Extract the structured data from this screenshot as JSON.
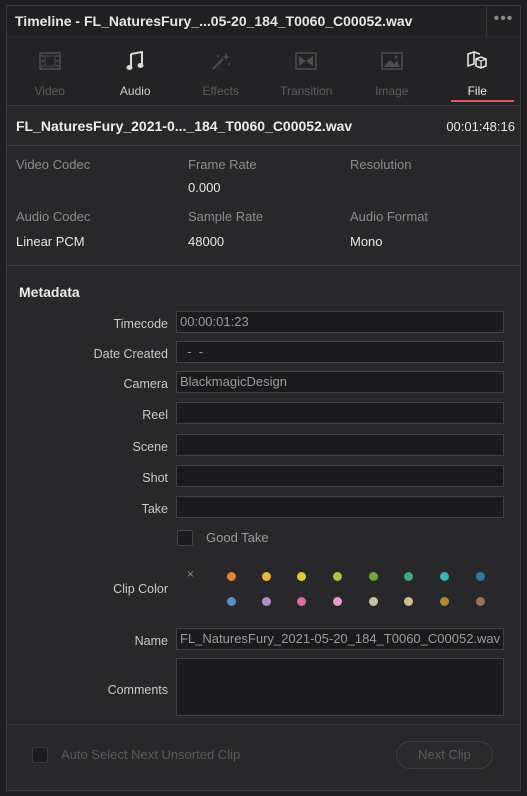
{
  "window": {
    "title": "Timeline - FL_NaturesFury_...05-20_184_T0060_C00052.wav",
    "menu": "•••"
  },
  "tabs": [
    {
      "label": "Video",
      "icon": "film-strip-icon",
      "state": "disabled"
    },
    {
      "label": "Audio",
      "icon": "music-note-icon",
      "state": "enabled"
    },
    {
      "label": "Effects",
      "icon": "magic-wand-icon",
      "state": "disabled"
    },
    {
      "label": "Transition",
      "icon": "transition-icon",
      "state": "disabled"
    },
    {
      "label": "Image",
      "icon": "image-icon",
      "state": "disabled"
    },
    {
      "label": "File",
      "icon": "file-cube-icon",
      "state": "active"
    }
  ],
  "file": {
    "name": "FL_NaturesFury_2021-0..._184_T0060_C00052.wav",
    "duration": "00:01:48:16"
  },
  "properties": {
    "video_codec": {
      "label": "Video Codec",
      "value": ""
    },
    "frame_rate": {
      "label": "Frame Rate",
      "value": "0.000"
    },
    "resolution": {
      "label": "Resolution",
      "value": ""
    },
    "audio_codec": {
      "label": "Audio Codec",
      "value": "Linear PCM"
    },
    "sample_rate": {
      "label": "Sample Rate",
      "value": "48000"
    },
    "audio_format": {
      "label": "Audio Format",
      "value": "Mono"
    }
  },
  "metadata": {
    "title": "Metadata",
    "timecode": {
      "label": "Timecode",
      "value": "00:00:01:23"
    },
    "date_created": {
      "label": "Date Created",
      "value": "  -  -"
    },
    "camera": {
      "label": "Camera",
      "value": "BlackmagicDesign"
    },
    "reel": {
      "label": "Reel",
      "value": ""
    },
    "scene": {
      "label": "Scene",
      "value": ""
    },
    "shot": {
      "label": "Shot",
      "value": ""
    },
    "take": {
      "label": "Take",
      "value": ""
    },
    "good_take": {
      "label": "Good Take",
      "checked": false
    },
    "clip_color": {
      "label": "Clip Color",
      "clear": "×",
      "colors": [
        "#e8822a",
        "#f0b43a",
        "#e0cc30",
        "#a8c83a",
        "#6aa83a",
        "#3aa880",
        "#32b8b8",
        "#2a7ab0",
        "#5a8ec8",
        "#b48ac8",
        "#e06aa0",
        "#e89ad0",
        "#c8c0a0",
        "#d8b888",
        "#b8862a",
        "#a07050"
      ]
    },
    "name": {
      "label": "Name",
      "value": "FL_NaturesFury_2021-05-20_184_T0060_C00052.wav"
    },
    "comments": {
      "label": "Comments",
      "value": ""
    }
  },
  "footer": {
    "auto_select": {
      "label": "Auto Select Next Unsorted Clip",
      "checked": false
    },
    "next_clip": "Next Clip"
  }
}
